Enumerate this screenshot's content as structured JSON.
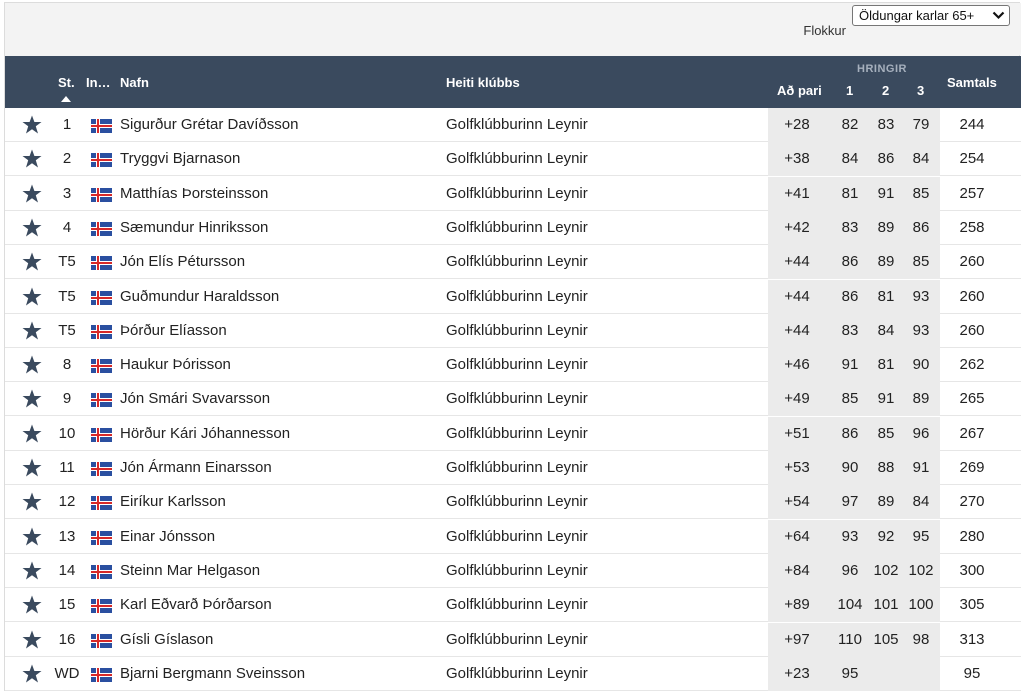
{
  "filter": {
    "selected": "Öldungar karlar 65+",
    "label": "Flokkur"
  },
  "header": {
    "pos": "St.",
    "init": "In…",
    "name": "Nafn",
    "club": "Heiti klúbbs",
    "group": "HRINGIR",
    "to_par": "Að pari",
    "r1": "1",
    "r2": "2",
    "r3": "3",
    "total": "Samtals"
  },
  "colors": {
    "header_bg": "#3a4a5e",
    "star": "#3a4a5e",
    "to_par_bg": "#ebebeb"
  },
  "rows": [
    {
      "pos": "1",
      "name": "Sigurður Grétar Davíðsson",
      "club": "Golfklúbburinn Leynir",
      "to_par": "+28",
      "r1": "82",
      "r2": "83",
      "r3": "79",
      "total": "244"
    },
    {
      "pos": "2",
      "name": "Tryggvi Bjarnason",
      "club": "Golfklúbburinn Leynir",
      "to_par": "+38",
      "r1": "84",
      "r2": "86",
      "r3": "84",
      "total": "254"
    },
    {
      "pos": "3",
      "name": "Matthías Þorsteinsson",
      "club": "Golfklúbburinn Leynir",
      "to_par": "+41",
      "r1": "81",
      "r2": "91",
      "r3": "85",
      "total": "257"
    },
    {
      "pos": "4",
      "name": "Sæmundur Hinriksson",
      "club": "Golfklúbburinn Leynir",
      "to_par": "+42",
      "r1": "83",
      "r2": "89",
      "r3": "86",
      "total": "258"
    },
    {
      "pos": "T5",
      "name": "Jón Elís Pétursson",
      "club": "Golfklúbburinn Leynir",
      "to_par": "+44",
      "r1": "86",
      "r2": "89",
      "r3": "85",
      "total": "260"
    },
    {
      "pos": "T5",
      "name": "Guðmundur Haraldsson",
      "club": "Golfklúbburinn Leynir",
      "to_par": "+44",
      "r1": "86",
      "r2": "81",
      "r3": "93",
      "total": "260"
    },
    {
      "pos": "T5",
      "name": "Þórður Elíasson",
      "club": "Golfklúbburinn Leynir",
      "to_par": "+44",
      "r1": "83",
      "r2": "84",
      "r3": "93",
      "total": "260"
    },
    {
      "pos": "8",
      "name": "Haukur Þórisson",
      "club": "Golfklúbburinn Leynir",
      "to_par": "+46",
      "r1": "91",
      "r2": "81",
      "r3": "90",
      "total": "262"
    },
    {
      "pos": "9",
      "name": "Jón Smári Svavarsson",
      "club": "Golfklúbburinn Leynir",
      "to_par": "+49",
      "r1": "85",
      "r2": "91",
      "r3": "89",
      "total": "265"
    },
    {
      "pos": "10",
      "name": "Hörður Kári Jóhannesson",
      "club": "Golfklúbburinn Leynir",
      "to_par": "+51",
      "r1": "86",
      "r2": "85",
      "r3": "96",
      "total": "267"
    },
    {
      "pos": "11",
      "name": "Jón Ármann Einarsson",
      "club": "Golfklúbburinn Leynir",
      "to_par": "+53",
      "r1": "90",
      "r2": "88",
      "r3": "91",
      "total": "269"
    },
    {
      "pos": "12",
      "name": "Eiríkur Karlsson",
      "club": "Golfklúbburinn Leynir",
      "to_par": "+54",
      "r1": "97",
      "r2": "89",
      "r3": "84",
      "total": "270"
    },
    {
      "pos": "13",
      "name": "Einar Jónsson",
      "club": "Golfklúbburinn Leynir",
      "to_par": "+64",
      "r1": "93",
      "r2": "92",
      "r3": "95",
      "total": "280"
    },
    {
      "pos": "14",
      "name": "Steinn Mar Helgason",
      "club": "Golfklúbburinn Leynir",
      "to_par": "+84",
      "r1": "96",
      "r2": "102",
      "r3": "102",
      "total": "300"
    },
    {
      "pos": "15",
      "name": "Karl Eðvarð Þórðarson",
      "club": "Golfklúbburinn Leynir",
      "to_par": "+89",
      "r1": "104",
      "r2": "101",
      "r3": "100",
      "total": "305"
    },
    {
      "pos": "16",
      "name": "Gísli Gíslason",
      "club": "Golfklúbburinn Leynir",
      "to_par": "+97",
      "r1": "110",
      "r2": "105",
      "r3": "98",
      "total": "313"
    },
    {
      "pos": "WD",
      "name": "Bjarni Bergmann Sveinsson",
      "club": "Golfklúbburinn Leynir",
      "to_par": "+23",
      "r1": "95",
      "r2": "",
      "r3": "",
      "total": "95"
    }
  ]
}
